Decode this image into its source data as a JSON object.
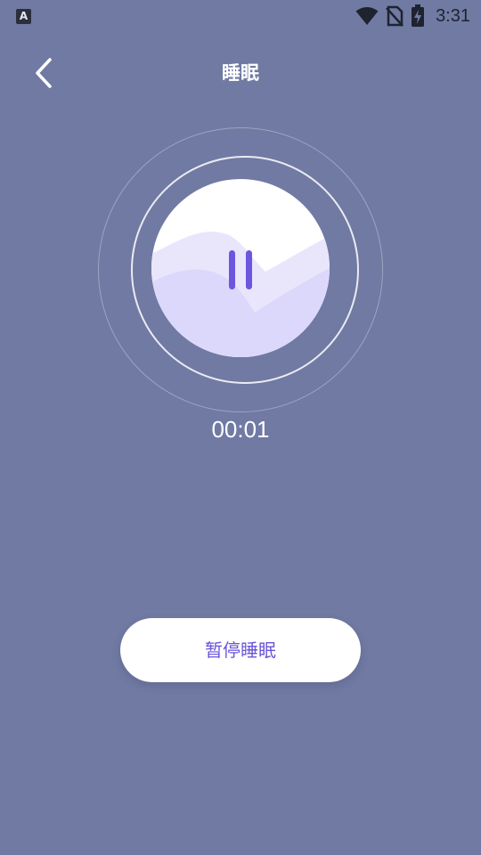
{
  "status_bar": {
    "app_icon_letter": "A",
    "time": "3:31",
    "icons": [
      "wifi-icon",
      "no-sim-icon",
      "battery-charging-icon"
    ]
  },
  "header": {
    "title": "睡眠",
    "back_icon": "chevron-left-icon"
  },
  "player": {
    "state": "playing",
    "control_icon": "pause-icon",
    "elapsed": "00:01"
  },
  "actions": {
    "pause_sleep_label": "暂停睡眠"
  },
  "colors": {
    "background": "#707aa3",
    "accent": "#6d55e0",
    "button_text": "#6b54d8",
    "wave_light": "#dcd8fb",
    "wave_lighter": "#e9e6fc"
  }
}
